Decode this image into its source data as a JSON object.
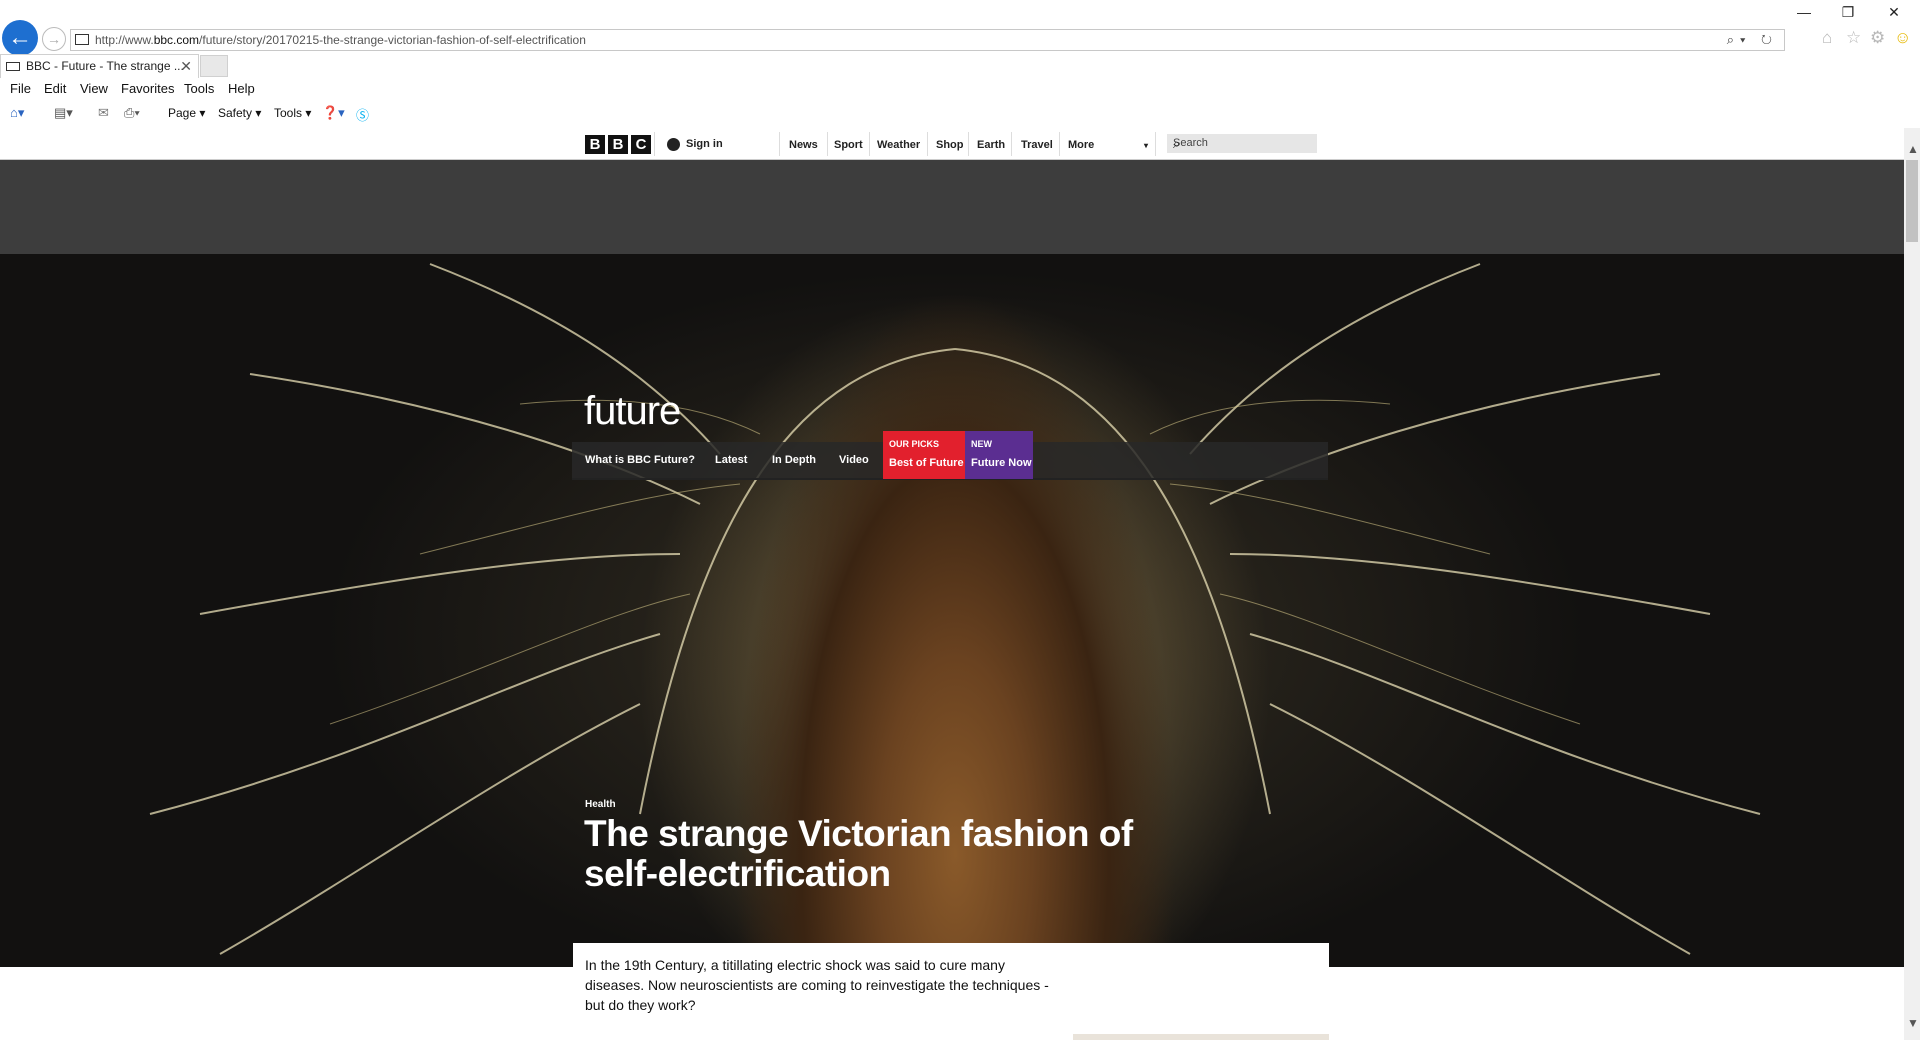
{
  "browser": {
    "url_prefix": "http://www.",
    "url_domain": "bbc.com",
    "url_path": "/future/story/20170215-the-strange-victorian-fashion-of-self-electrification",
    "tab_title": "BBC - Future - The strange ...",
    "address_icons": "⌕▾ ↻",
    "minimize": "—",
    "restore": "❐",
    "close": "✕",
    "tab_close": "✕"
  },
  "menu": [
    "File",
    "Edit",
    "View",
    "Favorites",
    "Tools",
    "Help"
  ],
  "command_bar": {
    "page": "Page ▾",
    "safety": "Safety ▾",
    "tools": "Tools ▾"
  },
  "bbc": {
    "logo": [
      "B",
      "B",
      "C"
    ],
    "sign_in": "Sign in",
    "nav": [
      "News",
      "Sport",
      "Weather",
      "Shop",
      "Earth",
      "Travel",
      "More"
    ],
    "search_placeholder": "Search"
  },
  "future": {
    "logo": "future",
    "nav": [
      "What is BBC Future?",
      "Latest",
      "In Depth",
      "Video"
    ],
    "picks_kicker": "OUR PICKS",
    "picks_label": "Best of Future",
    "new_kicker": "NEW",
    "new_label": "Future Now"
  },
  "article": {
    "category": "Health",
    "headline_line1": "The strange Victorian fashion of",
    "headline_line2": "self-electrification",
    "summary": "In the 19th Century, a titillating electric shock was said to cure many diseases. Now neuroscientists are coming to reinvestigate the techniques - but do they work?"
  },
  "colors": {
    "ie_blue": "#1e6fd0",
    "bbc_black": "#111111",
    "picks_red": "#e2202d",
    "new_purple": "#5b2e91",
    "ad_gray": "#3d3d3d"
  }
}
